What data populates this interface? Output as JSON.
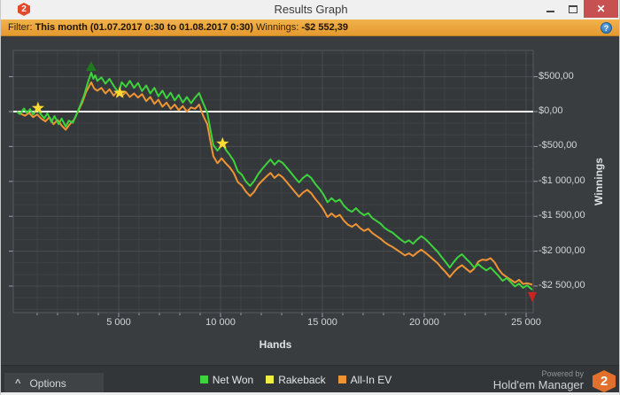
{
  "window": {
    "title": "Results Graph",
    "logo_text": "2"
  },
  "filter": {
    "prefix": "Filter:",
    "range_bold": "This month (01.07.2017 0:30 to 01.08.2017 0:30)",
    "winnings_label": "Winnings:",
    "winnings_value": "-$2 552,39",
    "help_glyph": "?"
  },
  "footer": {
    "options_label": "Options",
    "powered_by": "Powered by",
    "brand": "Hold'em Manager",
    "logo_text": "2"
  },
  "colors": {
    "net_won": "#3dd33d",
    "rakeback": "#f0ee3f",
    "all_in_ev": "#ee9434",
    "zero_line": "#ffffff",
    "grid_minor": "#3e4245",
    "grid_major": "#484c4f",
    "plot_border": "#55595c",
    "tick": "#9aa0a4",
    "filter_bar": "#e8a33b",
    "close_button": "#c75050"
  },
  "chart_data": {
    "type": "line",
    "title": "",
    "xlabel": "Hands",
    "ylabel": "Winnings",
    "xlim": [
      0,
      25350
    ],
    "ylim": [
      -2880,
      875
    ],
    "x_tick_step_minor": 1000,
    "y_tick_step_minor": 166.667,
    "grid": true,
    "legend_position": "bottom-center",
    "x_ticks": [
      {
        "label": "5 000",
        "value": 5000
      },
      {
        "label": "10 000",
        "value": 10000
      },
      {
        "label": "15 000",
        "value": 15000
      },
      {
        "label": "20 000",
        "value": 20000
      },
      {
        "label": "25 000",
        "value": 25000
      }
    ],
    "y_ticks": [
      {
        "label": "$500,00",
        "value": 500
      },
      {
        "label": "$0,00",
        "value": 0
      },
      {
        "label": "-$500,00",
        "value": -500
      },
      {
        "label": "-$1 000,00",
        "value": -1000
      },
      {
        "label": "-$1 500,00",
        "value": -1500
      },
      {
        "label": "-$2 000,00",
        "value": -2000
      },
      {
        "label": "-$2 500,00",
        "value": -2500
      }
    ],
    "legend": [
      {
        "label": "Net Won",
        "color": "#3dd33d"
      },
      {
        "label": "Rakeback",
        "color": "#f0ee3f"
      },
      {
        "label": "All-In EV",
        "color": "#ee9434"
      }
    ],
    "series": [
      {
        "name": "Rakeback",
        "color": "#f0ee3f",
        "points": [
          [
            0,
            0
          ],
          [
            25300,
            0
          ]
        ]
      },
      {
        "name": "All-In EV",
        "color": "#ee9434",
        "points": [
          [
            0,
            0
          ],
          [
            200,
            -30
          ],
          [
            400,
            -60
          ],
          [
            600,
            -20
          ],
          [
            800,
            -80
          ],
          [
            1000,
            -40
          ],
          [
            1200,
            -100
          ],
          [
            1400,
            -140
          ],
          [
            1600,
            -80
          ],
          [
            1800,
            -180
          ],
          [
            2000,
            -120
          ],
          [
            2200,
            -200
          ],
          [
            2400,
            -260
          ],
          [
            2600,
            -180
          ],
          [
            2800,
            -120
          ],
          [
            3000,
            0
          ],
          [
            3200,
            120
          ],
          [
            3400,
            280
          ],
          [
            3650,
            420
          ],
          [
            3800,
            330
          ],
          [
            3950,
            300
          ],
          [
            4150,
            340
          ],
          [
            4350,
            260
          ],
          [
            4550,
            320
          ],
          [
            4750,
            230
          ],
          [
            4950,
            290
          ],
          [
            5150,
            220
          ],
          [
            5350,
            280
          ],
          [
            5550,
            210
          ],
          [
            5750,
            260
          ],
          [
            5950,
            200
          ],
          [
            6150,
            250
          ],
          [
            6350,
            150
          ],
          [
            6550,
            210
          ],
          [
            6750,
            110
          ],
          [
            6950,
            170
          ],
          [
            7150,
            70
          ],
          [
            7350,
            130
          ],
          [
            7550,
            40
          ],
          [
            7750,
            100
          ],
          [
            7950,
            20
          ],
          [
            8150,
            80
          ],
          [
            8350,
            0
          ],
          [
            8550,
            60
          ],
          [
            8750,
            40
          ],
          [
            8950,
            100
          ],
          [
            9150,
            -60
          ],
          [
            9350,
            -180
          ],
          [
            9500,
            -420
          ],
          [
            9650,
            -640
          ],
          [
            9850,
            -740
          ],
          [
            10050,
            -670
          ],
          [
            10250,
            -740
          ],
          [
            10450,
            -800
          ],
          [
            10650,
            -880
          ],
          [
            10850,
            -1010
          ],
          [
            11050,
            -1060
          ],
          [
            11250,
            -1150
          ],
          [
            11450,
            -1210
          ],
          [
            11650,
            -1150
          ],
          [
            11850,
            -1050
          ],
          [
            12050,
            -990
          ],
          [
            12250,
            -930
          ],
          [
            12450,
            -880
          ],
          [
            12650,
            -950
          ],
          [
            12850,
            -900
          ],
          [
            13050,
            -940
          ],
          [
            13250,
            -1010
          ],
          [
            13450,
            -1080
          ],
          [
            13650,
            -1150
          ],
          [
            13850,
            -1220
          ],
          [
            14050,
            -1160
          ],
          [
            14250,
            -1120
          ],
          [
            14450,
            -1170
          ],
          [
            14650,
            -1250
          ],
          [
            14850,
            -1320
          ],
          [
            15050,
            -1400
          ],
          [
            15250,
            -1510
          ],
          [
            15450,
            -1460
          ],
          [
            15650,
            -1510
          ],
          [
            15850,
            -1480
          ],
          [
            16050,
            -1560
          ],
          [
            16250,
            -1620
          ],
          [
            16450,
            -1650
          ],
          [
            16650,
            -1610
          ],
          [
            16850,
            -1670
          ],
          [
            17050,
            -1710
          ],
          [
            17250,
            -1680
          ],
          [
            17450,
            -1740
          ],
          [
            17650,
            -1780
          ],
          [
            17850,
            -1820
          ],
          [
            18050,
            -1870
          ],
          [
            18250,
            -1910
          ],
          [
            18450,
            -1940
          ],
          [
            18650,
            -1980
          ],
          [
            18850,
            -2020
          ],
          [
            19050,
            -2060
          ],
          [
            19250,
            -2030
          ],
          [
            19450,
            -2070
          ],
          [
            19650,
            -2020
          ],
          [
            19850,
            -1980
          ],
          [
            20050,
            -2020
          ],
          [
            20250,
            -2070
          ],
          [
            20450,
            -2120
          ],
          [
            20650,
            -2170
          ],
          [
            20850,
            -2240
          ],
          [
            21050,
            -2300
          ],
          [
            21250,
            -2370
          ],
          [
            21450,
            -2300
          ],
          [
            21650,
            -2240
          ],
          [
            21850,
            -2200
          ],
          [
            22050,
            -2250
          ],
          [
            22250,
            -2300
          ],
          [
            22450,
            -2250
          ],
          [
            22650,
            -2150
          ],
          [
            22850,
            -2120
          ],
          [
            23050,
            -2130
          ],
          [
            23250,
            -2100
          ],
          [
            23450,
            -2160
          ],
          [
            23650,
            -2260
          ],
          [
            23850,
            -2330
          ],
          [
            24050,
            -2370
          ],
          [
            24250,
            -2410
          ],
          [
            24450,
            -2450
          ],
          [
            24650,
            -2410
          ],
          [
            24850,
            -2470
          ],
          [
            25050,
            -2460
          ],
          [
            25300,
            -2480
          ]
        ]
      },
      {
        "name": "Net Won",
        "color": "#3dd33d",
        "points": [
          [
            0,
            0
          ],
          [
            150,
            -35
          ],
          [
            350,
            45
          ],
          [
            500,
            -20
          ],
          [
            650,
            35
          ],
          [
            800,
            -45
          ],
          [
            1000,
            50
          ],
          [
            1150,
            -30
          ],
          [
            1350,
            -95
          ],
          [
            1500,
            -25
          ],
          [
            1700,
            -150
          ],
          [
            1850,
            -65
          ],
          [
            2050,
            -180
          ],
          [
            2200,
            -100
          ],
          [
            2400,
            -215
          ],
          [
            2550,
            -130
          ],
          [
            2750,
            -160
          ],
          [
            2900,
            -60
          ],
          [
            3100,
            80
          ],
          [
            3300,
            230
          ],
          [
            3500,
            430
          ],
          [
            3650,
            560
          ],
          [
            3750,
            470
          ],
          [
            3850,
            520
          ],
          [
            3950,
            440
          ],
          [
            4150,
            490
          ],
          [
            4350,
            400
          ],
          [
            4550,
            470
          ],
          [
            4750,
            370
          ],
          [
            5000,
            270
          ],
          [
            5150,
            420
          ],
          [
            5350,
            355
          ],
          [
            5550,
            440
          ],
          [
            5750,
            340
          ],
          [
            5950,
            410
          ],
          [
            6150,
            295
          ],
          [
            6350,
            375
          ],
          [
            6550,
            260
          ],
          [
            6750,
            340
          ],
          [
            6950,
            220
          ],
          [
            7150,
            300
          ],
          [
            7350,
            190
          ],
          [
            7550,
            270
          ],
          [
            7750,
            160
          ],
          [
            7950,
            240
          ],
          [
            8150,
            130
          ],
          [
            8350,
            210
          ],
          [
            8550,
            120
          ],
          [
            8750,
            200
          ],
          [
            8950,
            265
          ],
          [
            9150,
            120
          ],
          [
            9350,
            -15
          ],
          [
            9500,
            -255
          ],
          [
            9650,
            -480
          ],
          [
            9850,
            -560
          ],
          [
            10100,
            -460
          ],
          [
            10250,
            -545
          ],
          [
            10450,
            -620
          ],
          [
            10650,
            -705
          ],
          [
            10850,
            -855
          ],
          [
            11050,
            -905
          ],
          [
            11250,
            -1005
          ],
          [
            11450,
            -1065
          ],
          [
            11650,
            -995
          ],
          [
            11850,
            -895
          ],
          [
            12050,
            -820
          ],
          [
            12250,
            -750
          ],
          [
            12450,
            -685
          ],
          [
            12650,
            -760
          ],
          [
            12850,
            -700
          ],
          [
            13050,
            -735
          ],
          [
            13250,
            -805
          ],
          [
            13450,
            -875
          ],
          [
            13650,
            -945
          ],
          [
            13850,
            -1015
          ],
          [
            14050,
            -950
          ],
          [
            14250,
            -905
          ],
          [
            14450,
            -950
          ],
          [
            14650,
            -1035
          ],
          [
            14850,
            -1105
          ],
          [
            15050,
            -1185
          ],
          [
            15250,
            -1300
          ],
          [
            15450,
            -1240
          ],
          [
            15650,
            -1290
          ],
          [
            15850,
            -1260
          ],
          [
            16050,
            -1345
          ],
          [
            16250,
            -1405
          ],
          [
            16450,
            -1435
          ],
          [
            16650,
            -1385
          ],
          [
            16850,
            -1445
          ],
          [
            17050,
            -1485
          ],
          [
            17250,
            -1455
          ],
          [
            17450,
            -1525
          ],
          [
            17650,
            -1565
          ],
          [
            17850,
            -1605
          ],
          [
            18050,
            -1665
          ],
          [
            18250,
            -1705
          ],
          [
            18450,
            -1735
          ],
          [
            18650,
            -1785
          ],
          [
            18850,
            -1835
          ],
          [
            19050,
            -1875
          ],
          [
            19250,
            -1845
          ],
          [
            19450,
            -1895
          ],
          [
            19650,
            -1835
          ],
          [
            19850,
            -1785
          ],
          [
            20050,
            -1825
          ],
          [
            20250,
            -1885
          ],
          [
            20450,
            -1945
          ],
          [
            20650,
            -2005
          ],
          [
            20850,
            -2085
          ],
          [
            21050,
            -2155
          ],
          [
            21250,
            -2235
          ],
          [
            21450,
            -2155
          ],
          [
            21650,
            -2085
          ],
          [
            21850,
            -2045
          ],
          [
            22050,
            -2105
          ],
          [
            22250,
            -2165
          ],
          [
            22450,
            -2235
          ],
          [
            22650,
            -2185
          ],
          [
            22850,
            -2235
          ],
          [
            23050,
            -2275
          ],
          [
            23250,
            -2235
          ],
          [
            23450,
            -2295
          ],
          [
            23650,
            -2355
          ],
          [
            23850,
            -2425
          ],
          [
            24050,
            -2385
          ],
          [
            24250,
            -2445
          ],
          [
            24450,
            -2505
          ],
          [
            24650,
            -2465
          ],
          [
            24850,
            -2525
          ],
          [
            25050,
            -2490
          ],
          [
            25300,
            -2552
          ]
        ]
      }
    ],
    "markers": [
      {
        "type": "star",
        "hands": 1040,
        "value": 50,
        "color": "#ffd935"
      },
      {
        "type": "triangle-up",
        "hands": 3650,
        "value": 645,
        "color": "#1f7a1f"
      },
      {
        "type": "star",
        "hands": 5050,
        "value": 268,
        "color": "#ffd935"
      },
      {
        "type": "star",
        "hands": 10100,
        "value": -460,
        "color": "#ffd935"
      },
      {
        "type": "triangle-down",
        "hands": 25300,
        "value": -2650,
        "color": "#cc2222"
      }
    ],
    "zero_line_value": 0
  }
}
